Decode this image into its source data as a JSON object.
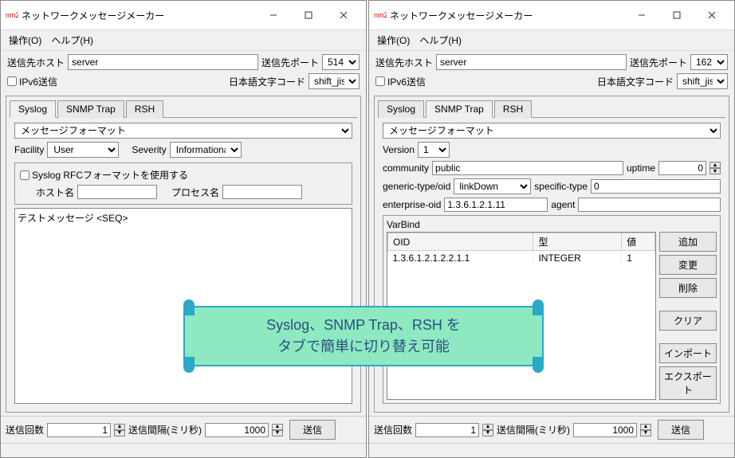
{
  "app_icon_text": "nm2",
  "window_title": "ネットワークメッセージメーカー",
  "menubar": {
    "operation": "操作(O)",
    "help": "ヘルプ(H)"
  },
  "common": {
    "dest_host_label": "送信先ホスト",
    "dest_host_value": "server",
    "dest_port_label": "送信先ポート",
    "ipv6_label": "IPv6送信",
    "encoding_label": "日本語文字コード",
    "encoding_value": "shift_jis",
    "tabs": {
      "syslog": "Syslog",
      "snmp": "SNMP Trap",
      "rsh": "RSH"
    },
    "msg_format_label": "メッセージフォーマット",
    "send_count_label": "送信回数",
    "send_interval_label": "送信間隔(ミリ秒)",
    "send_button": "送信",
    "send_count_value": "1",
    "send_interval_value": "1000"
  },
  "left": {
    "port": "514",
    "facility_label": "Facility",
    "facility_value": "User",
    "severity_label": "Severity",
    "severity_value": "Informational",
    "rfc_label": "Syslog RFCフォーマットを使用する",
    "hostname_label": "ホスト名",
    "procname_label": "プロセス名",
    "message_value": "テストメッセージ <SEQ>"
  },
  "right": {
    "port": "162",
    "version_label": "Version",
    "version_value": "1",
    "community_label": "community",
    "community_value": "public",
    "uptime_label": "uptime",
    "uptime_value": "0",
    "generic_label": "generic-type/oid",
    "generic_value": "linkDown",
    "specific_label": "specific-type",
    "specific_value": "0",
    "enterprise_label": "enterprise-oid",
    "enterprise_value": "1.3.6.1.2.1.11",
    "agent_label": "agent",
    "agent_value": "",
    "varbind_title": "VarBind",
    "vb_headers": {
      "oid": "OID",
      "type": "型",
      "value": "値"
    },
    "vb_row": {
      "oid": "1.3.6.1.2.1.2.2.1.1",
      "type": "INTEGER",
      "value": "1"
    },
    "btns": {
      "add": "追加",
      "edit": "変更",
      "delete": "削除",
      "clear": "クリア",
      "import": "インポート",
      "export": "エクスポート"
    }
  },
  "callout": {
    "line1": "Syslog、SNMP Trap、RSH を",
    "line2": "タブで簡単に切り替え可能"
  }
}
